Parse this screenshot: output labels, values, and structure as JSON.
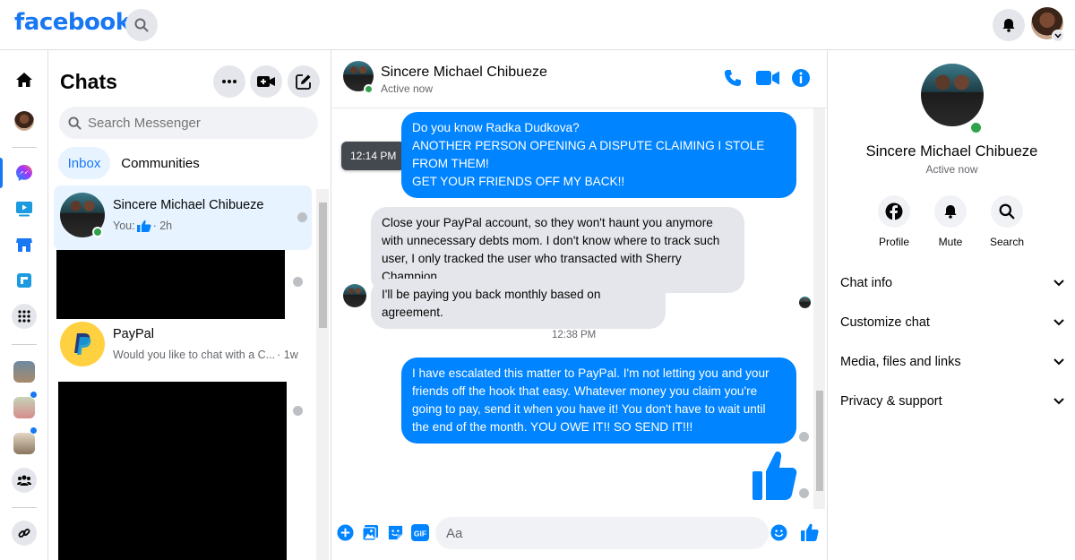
{
  "topbar": {
    "logo": "facebook",
    "search_icon": "search-icon",
    "notifications_icon": "bell-icon"
  },
  "rail": {
    "items": [
      "home-icon",
      "profile-avatar",
      "messenger-icon",
      "watch-icon",
      "marketplace-icon",
      "gaming-icon",
      "menu-grid-icon",
      "contact-avatar",
      "contact-avatar",
      "contact-avatar",
      "groups-icon",
      "link-icon"
    ]
  },
  "chats": {
    "title": "Chats",
    "search_placeholder": "Search Messenger",
    "tabs": [
      "Inbox",
      "Communities"
    ],
    "items": [
      {
        "name": "Sincere Michael Chibueze",
        "preview": "You:",
        "time": "· 2h",
        "selected": true
      },
      {
        "name": "PayPal",
        "preview": "Would you like to chat with a C...",
        "time": "· 1w",
        "selected": false
      }
    ]
  },
  "conversation": {
    "name": "Sincere Michael Chibueze",
    "status": "Active now",
    "tooltip": "12:14 PM",
    "messages": [
      {
        "from": "me",
        "text": "Do you know Radka Dudkova?\nANOTHER PERSON OPENING A DISPUTE CLAIMING I STOLE FROM THEM!\nGET YOUR FRIENDS OFF MY BACK!!"
      },
      {
        "from": "them",
        "text": "Close your PayPal account, so they won't haunt you anymore with unnecessary debts mom. I don't know where to track such user, I only tracked the user who transacted with Sherry Champion."
      },
      {
        "from": "them",
        "text": "I'll be paying you back monthly based on agreement."
      },
      {
        "from": "me",
        "text": "I have escalated this matter to PayPal.  I'm not letting you and your friends off the hook that easy.  Whatever money you claim you're going to pay, send it when you have it!  You don't have to wait until the end of the month.  YOU OWE IT!! SO  SEND IT!!!"
      }
    ],
    "timestamp": "12:38 PM",
    "composer_placeholder": "Aa"
  },
  "info_panel": {
    "name": "Sincere Michael Chibueze",
    "status": "Active now",
    "actions": [
      "Profile",
      "Mute",
      "Search"
    ],
    "sections": [
      "Chat info",
      "Customize chat",
      "Media, files and links",
      "Privacy & support"
    ]
  },
  "colors": {
    "brand": "#1877f2",
    "my_bubble": "#0084ff",
    "their_bubble": "#e4e6eb",
    "online": "#31a24c"
  }
}
